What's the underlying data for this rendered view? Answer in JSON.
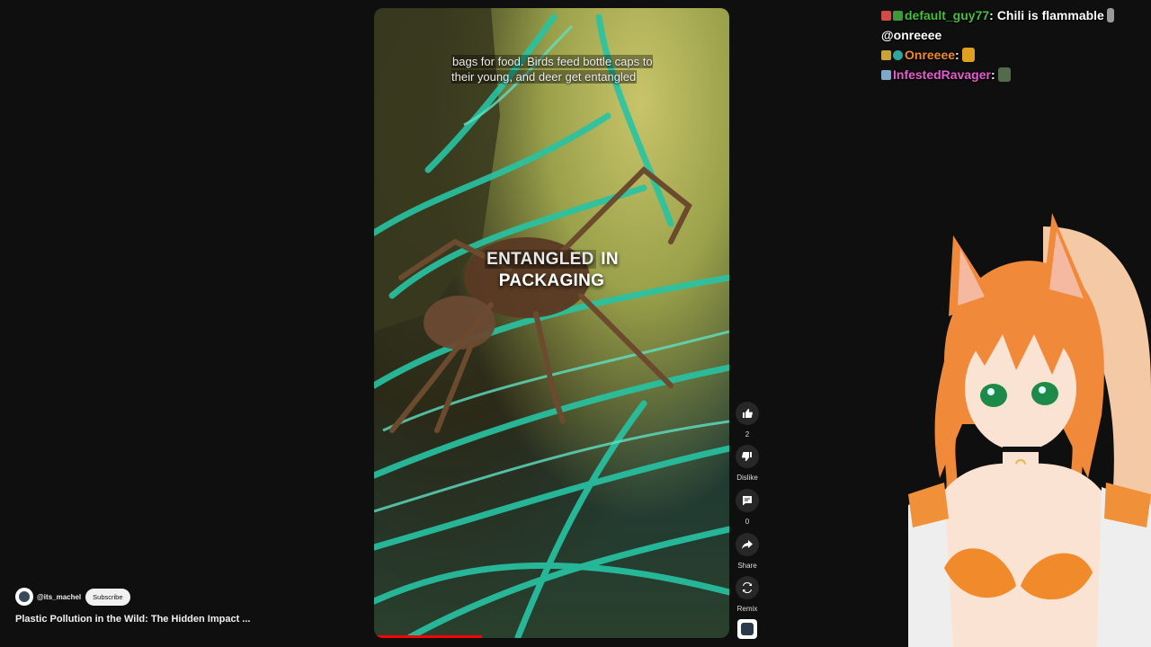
{
  "video": {
    "caption_top": "bags for food. Birds feed bottle caps to their young, and deer get entangled",
    "caption_main_word1": "ENTANGLED",
    "caption_main_word2": "IN",
    "caption_main_line2": "PACKAGING"
  },
  "actions": {
    "like_count": "2",
    "dislike_label": "Dislike",
    "comment_count": "0",
    "share_label": "Share",
    "remix_label": "Remix"
  },
  "channel": {
    "handle": "@its_machel",
    "subscribe_label": "Subscribe"
  },
  "video_title": "Plastic Pollution in the Wild: The Hidden Impact ...",
  "chat": {
    "messages": [
      {
        "user": "default_guy77",
        "sep": ":",
        "text": "Chili is flammable",
        "color": "#44c13a"
      },
      {
        "user": "",
        "sep": "",
        "text": "@onreeee",
        "color": "#ffffff"
      },
      {
        "user": "Onreeee",
        "sep": ":",
        "text": "",
        "color": "#f08a2b"
      },
      {
        "user": "InfestedRavager",
        "sep": ":",
        "text": "",
        "color": "#e85bd0"
      }
    ]
  },
  "icons": {
    "like": "thumbs-up-icon",
    "dislike": "thumbs-down-icon",
    "comment": "comment-icon",
    "share": "share-icon",
    "remix": "remix-icon"
  },
  "colors": {
    "background": "#0f0f0f",
    "progress": "#ff0000",
    "button_bg": "#272727",
    "strand": "#27c4a4"
  }
}
